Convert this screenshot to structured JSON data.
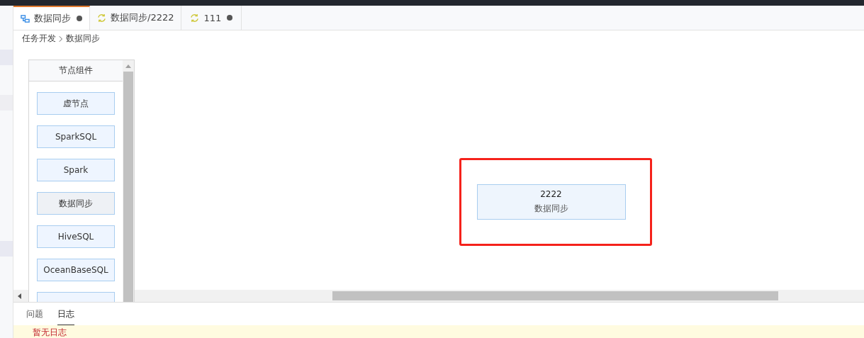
{
  "tabs": [
    {
      "label": "数据同步",
      "kind": "flow",
      "selected": true,
      "modified": true
    },
    {
      "label": "数据同步/2222",
      "kind": "sync",
      "selected": false,
      "modified": false
    },
    {
      "label": "111",
      "kind": "sync",
      "selected": false,
      "modified": true
    }
  ],
  "breadcrumb": [
    "任务开发",
    "数据同步"
  ],
  "palette": {
    "title": "节点组件",
    "items": [
      {
        "label": "虚节点"
      },
      {
        "label": "SparkSQL"
      },
      {
        "label": "Spark"
      },
      {
        "label": "数据同步"
      },
      {
        "label": "HiveSQL"
      },
      {
        "label": "OceanBaseSQL"
      }
    ]
  },
  "canvas": {
    "node": {
      "title": "2222",
      "type": "数据同步",
      "highlighted": true
    }
  },
  "bottom_panel": {
    "tabs": [
      {
        "label": "问题",
        "selected": false
      },
      {
        "label": "日志",
        "selected": true
      }
    ],
    "log": "暂无日志"
  }
}
